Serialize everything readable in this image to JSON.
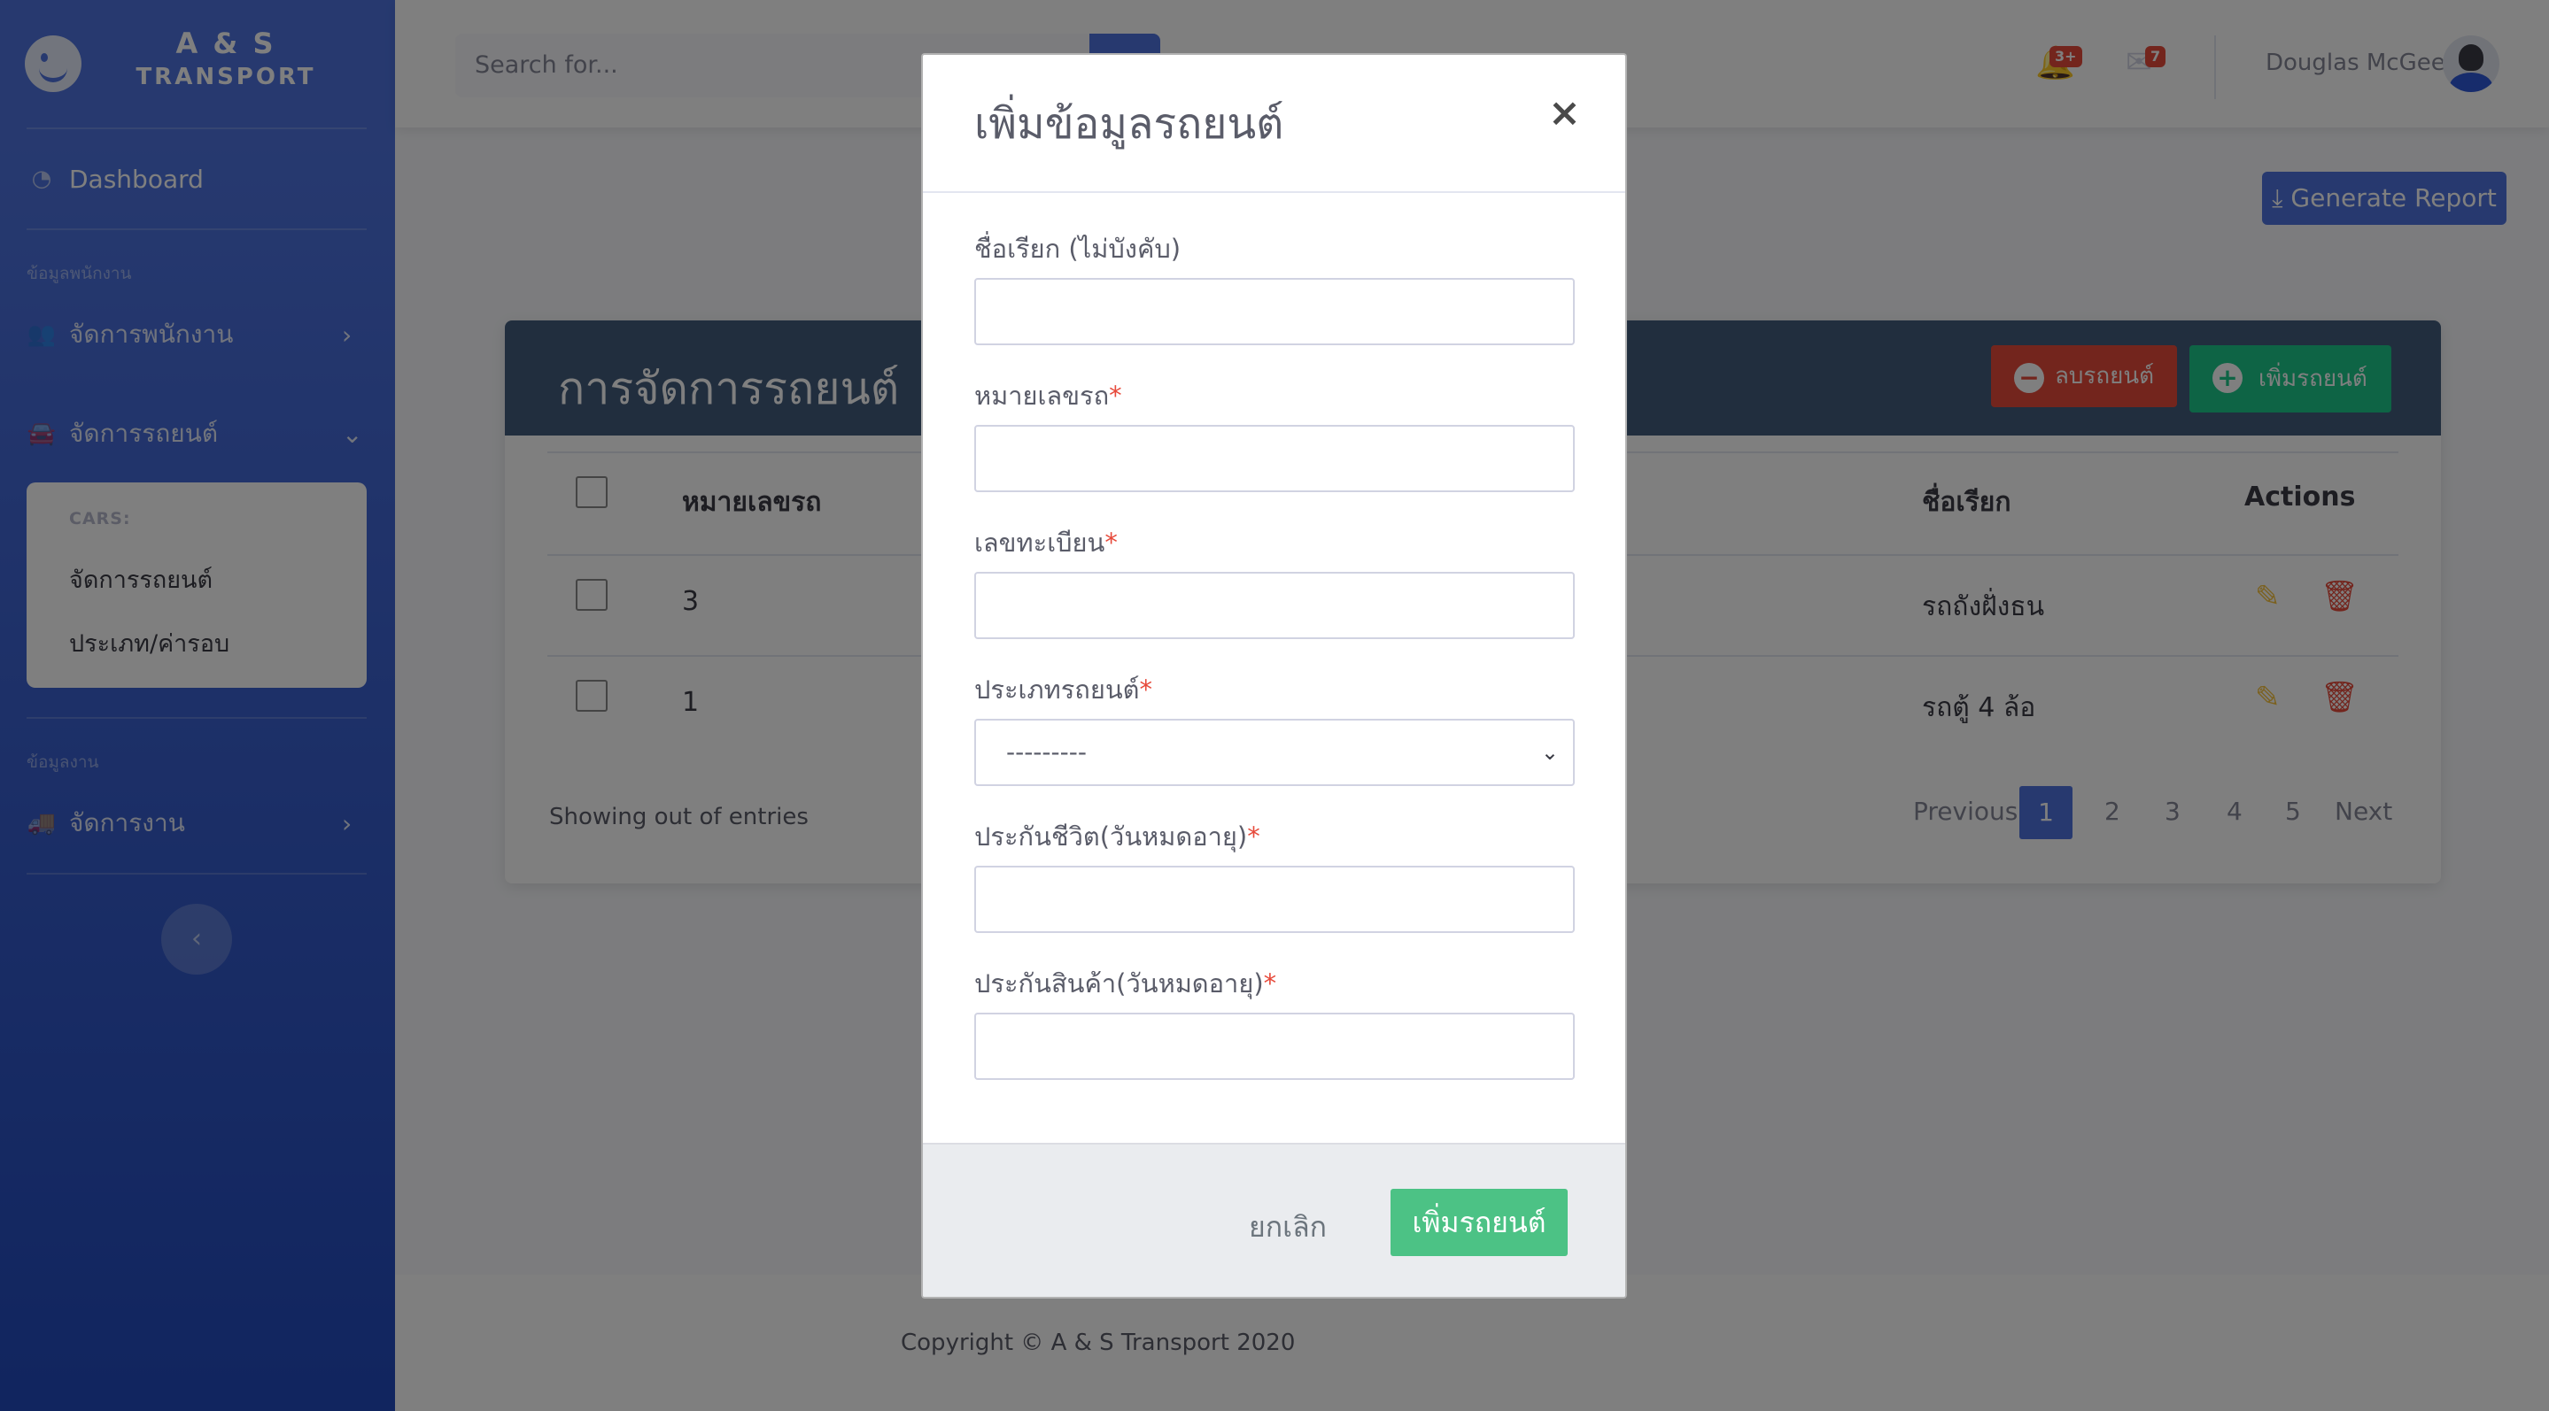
{
  "brand": {
    "line1": "A & S",
    "line2": "TRANSPORT"
  },
  "sidebar": {
    "dashboard": "Dashboard",
    "heading_employees": "ข้อมูลพนักงาน",
    "manage_employees": "จัดการพนักงาน",
    "manage_cars": "จัดการรถยนต์",
    "cars_header": "CARS:",
    "cars_items": [
      "จัดการรถยนต์",
      "ประเภท/ค่ารอบ"
    ],
    "heading_jobs": "ข้อมูลงาน",
    "manage_jobs": "จัดการงาน"
  },
  "topbar": {
    "search_placeholder": "Search for...",
    "alerts_badge": "3+",
    "messages_badge": "7",
    "username": "Douglas McGee"
  },
  "content": {
    "generate_report": "Generate Report",
    "card_title": "การจัดการรถยนต์",
    "delete_button": "ลบรถยนต์",
    "add_button": "เพิ่มรถยนต์",
    "columns": {
      "car_number": "หมายเลขรถ",
      "nickname": "ชื่อเรียก",
      "actions": "Actions"
    },
    "rows": [
      {
        "car_number": "3",
        "nickname": "รถถังฝั่งธน"
      },
      {
        "car_number": "1",
        "nickname": "รถตู้ 4 ล้อ"
      }
    ],
    "showing": "Showing out of entries",
    "pagination": {
      "previous": "Previous",
      "pages": [
        "1",
        "2",
        "3",
        "4",
        "5"
      ],
      "next": "Next"
    }
  },
  "footer": {
    "copyright": "Copyright © A & S Transport 2020"
  },
  "modal": {
    "title": "เพิ่มข้อมูลรถยนต์",
    "close": "×",
    "fields": {
      "nickname_label": "ชื่อเรียก (ไม่บังคับ)",
      "car_number_label": "หมายเลขรถ",
      "registration_label": "เลขทะเบียน",
      "type_label": "ประเภทรถยนต์",
      "type_selected": "---------",
      "life_insurance_label": "ประกันชีวิต(วันหมดอายุ)",
      "cargo_insurance_label": "ประกันสินค้า(วันหมดอายุ)",
      "required_mark": "*"
    },
    "cancel": "ยกเลิก",
    "submit": "เพิ่มรถยนต์"
  },
  "colors": {
    "primary": "#4e73df",
    "danger": "#e74a3b",
    "success": "#1cc88a",
    "card_header": "#435d7d",
    "warning_icon": "#f6c23e"
  },
  "icons": [
    "laugh-wink-icon",
    "tachometer-icon",
    "users-icon",
    "car-icon",
    "truck-icon",
    "search-icon",
    "bell-icon",
    "envelope-icon",
    "download-icon",
    "pencil-icon",
    "trash-icon",
    "chevron-left-icon",
    "chevron-right-icon",
    "chevron-down-icon"
  ]
}
